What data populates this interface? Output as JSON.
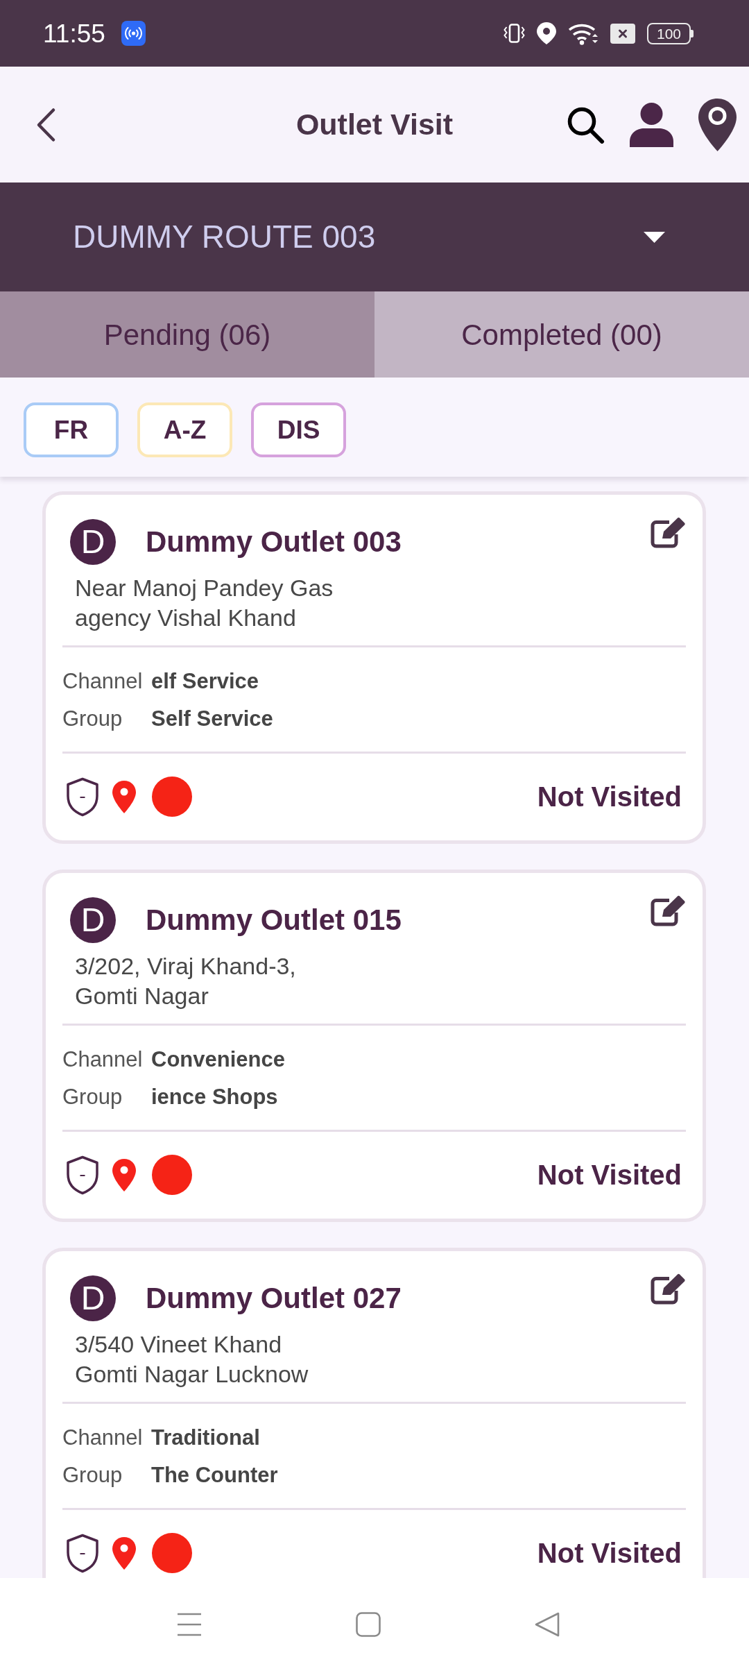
{
  "status_bar": {
    "time": "11:55",
    "battery": "100"
  },
  "header": {
    "title": "Outlet Visit"
  },
  "route": {
    "name": "DUMMY ROUTE 003"
  },
  "tabs": [
    {
      "label": "Pending (06)",
      "selected": true
    },
    {
      "label": "Completed (00)",
      "selected": false
    }
  ],
  "filters": [
    {
      "label": "FR",
      "color": "#a9cbf6"
    },
    {
      "label": "A-Z",
      "color": "#fce8b6"
    },
    {
      "label": "DIS",
      "color": "#d6a2dd"
    }
  ],
  "outlets": [
    {
      "initial": "D",
      "name": "Dummy Outlet 003",
      "address_lines": [
        "Near Manoj Pandey Gas",
        "agency Vishal Khand"
      ],
      "details": [
        {
          "label": "Channel",
          "value": "elf Service"
        },
        {
          "label": "Group",
          "value": "Self Service"
        }
      ],
      "color": "#f52316",
      "status": "Not Visited"
    },
    {
      "initial": "D",
      "name": "Dummy Outlet 015",
      "address_lines": [
        "3/202, Viraj Khand-3,",
        "Gomti Nagar"
      ],
      "details": [
        {
          "label": "Channel",
          "value": "Convenience"
        },
        {
          "label": "Group",
          "value": "ience Shops"
        }
      ],
      "color": "#f52316",
      "status": "Not Visited"
    },
    {
      "initial": "D",
      "name": "Dummy Outlet 027",
      "address_lines": [
        "3/540 Vineet Khand",
        "Gomti Nagar Lucknow"
      ],
      "details": [
        {
          "label": "Channel",
          "value": "Traditional"
        },
        {
          "label": "Group",
          "value": "The Counter"
        }
      ],
      "color": "#f52316",
      "status": "Not Visited"
    }
  ]
}
